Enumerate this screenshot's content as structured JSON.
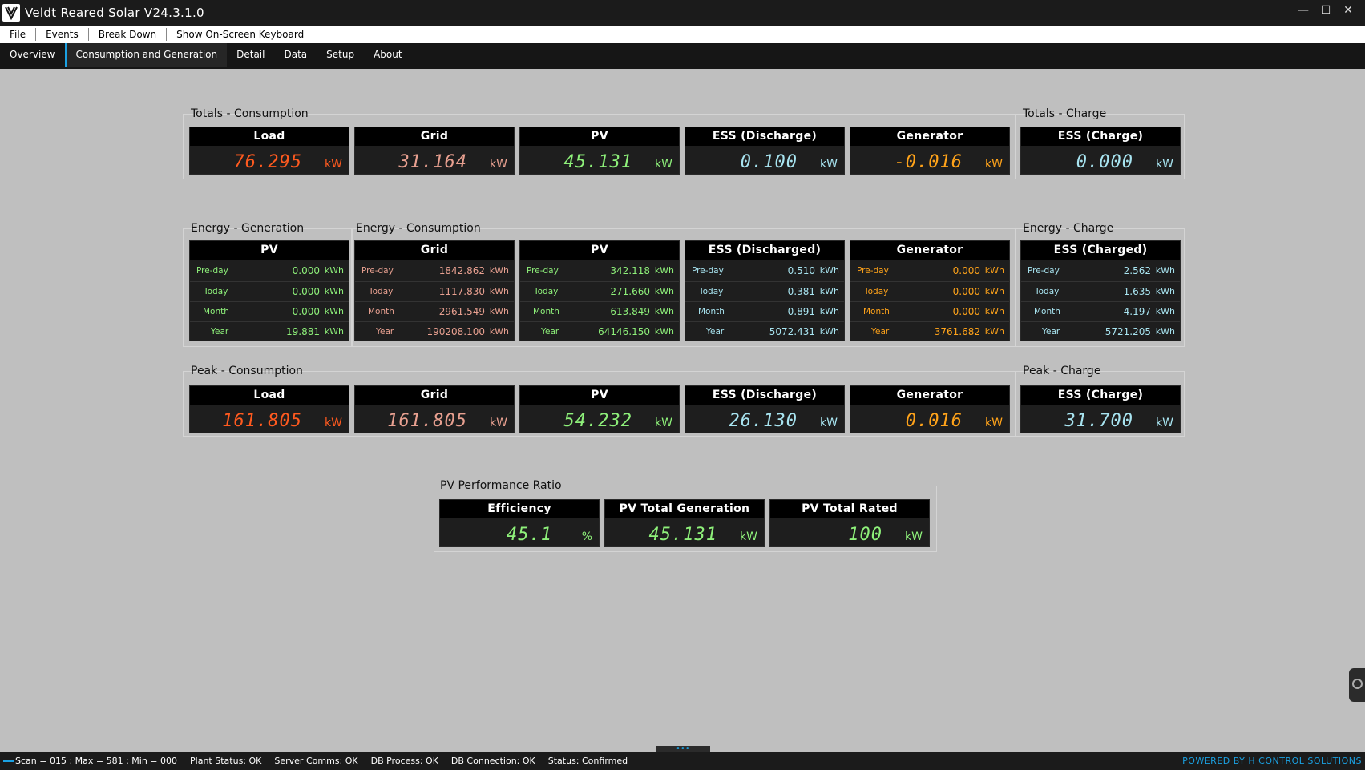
{
  "window": {
    "title": "Veldt Reared Solar V24.3.1.0",
    "controls": {
      "minimize": "—",
      "maximize": "☐",
      "close": "✕"
    }
  },
  "menu": [
    "File",
    "Events",
    "Break Down",
    "Show On-Screen Keyboard"
  ],
  "tabs": [
    "Overview",
    "Consumption and Generation",
    "Detail",
    "Data",
    "Setup",
    "About"
  ],
  "active_tab": "Consumption and Generation",
  "colors": {
    "load": "#ff5a1f",
    "grid": "#e8a090",
    "pv": "#8ef07a",
    "ess": "#a8e4f0",
    "generator": "#ffa31a",
    "accent": "#1ba1e2"
  },
  "totals_consumption": {
    "label": "Totals - Consumption",
    "cards": [
      {
        "title": "Load",
        "value": "76.295",
        "unit": "kW"
      },
      {
        "title": "Grid",
        "value": "31.164",
        "unit": "kW"
      },
      {
        "title": "PV",
        "value": "45.131",
        "unit": "kW"
      },
      {
        "title": "ESS (Discharge)",
        "value": "0.100",
        "unit": "kW"
      },
      {
        "title": "Generator",
        "value": "-0.016",
        "unit": "kW"
      }
    ]
  },
  "totals_charge": {
    "label": "Totals - Charge",
    "card": {
      "title": "ESS (Charge)",
      "value": "0.000",
      "unit": "kW"
    }
  },
  "energy_generation": {
    "label": "Energy - Generation",
    "card": {
      "title": "PV",
      "rows": [
        {
          "label": "Pre-day",
          "value": "0.000",
          "unit": "kWh"
        },
        {
          "label": "Today",
          "value": "0.000",
          "unit": "kWh"
        },
        {
          "label": "Month",
          "value": "0.000",
          "unit": "kWh"
        },
        {
          "label": "Year",
          "value": "19.881",
          "unit": "kWh"
        }
      ]
    }
  },
  "energy_consumption": {
    "label": "Energy - Consumption",
    "cards": [
      {
        "title": "Grid",
        "rows": [
          {
            "label": "Pre-day",
            "value": "1842.862",
            "unit": "kWh"
          },
          {
            "label": "Today",
            "value": "1117.830",
            "unit": "kWh"
          },
          {
            "label": "Month",
            "value": "2961.549",
            "unit": "kWh"
          },
          {
            "label": "Year",
            "value": "190208.100",
            "unit": "kWh"
          }
        ]
      },
      {
        "title": "PV",
        "rows": [
          {
            "label": "Pre-day",
            "value": "342.118",
            "unit": "kWh"
          },
          {
            "label": "Today",
            "value": "271.660",
            "unit": "kWh"
          },
          {
            "label": "Month",
            "value": "613.849",
            "unit": "kWh"
          },
          {
            "label": "Year",
            "value": "64146.150",
            "unit": "kWh"
          }
        ]
      },
      {
        "title": "ESS (Discharged)",
        "rows": [
          {
            "label": "Pre-day",
            "value": "0.510",
            "unit": "kWh"
          },
          {
            "label": "Today",
            "value": "0.381",
            "unit": "kWh"
          },
          {
            "label": "Month",
            "value": "0.891",
            "unit": "kWh"
          },
          {
            "label": "Year",
            "value": "5072.431",
            "unit": "kWh"
          }
        ]
      },
      {
        "title": "Generator",
        "rows": [
          {
            "label": "Pre-day",
            "value": "0.000",
            "unit": "kWh"
          },
          {
            "label": "Today",
            "value": "0.000",
            "unit": "kWh"
          },
          {
            "label": "Month",
            "value": "0.000",
            "unit": "kWh"
          },
          {
            "label": "Year",
            "value": "3761.682",
            "unit": "kWh"
          }
        ]
      }
    ]
  },
  "energy_charge": {
    "label": "Energy - Charge",
    "card": {
      "title": "ESS (Charged)",
      "rows": [
        {
          "label": "Pre-day",
          "value": "2.562",
          "unit": "kWh"
        },
        {
          "label": "Today",
          "value": "1.635",
          "unit": "kWh"
        },
        {
          "label": "Month",
          "value": "4.197",
          "unit": "kWh"
        },
        {
          "label": "Year",
          "value": "5721.205",
          "unit": "kWh"
        }
      ]
    }
  },
  "peak_consumption": {
    "label": "Peak - Consumption",
    "cards": [
      {
        "title": "Load",
        "value": "161.805",
        "unit": "kW"
      },
      {
        "title": "Grid",
        "value": "161.805",
        "unit": "kW"
      },
      {
        "title": "PV",
        "value": "54.232",
        "unit": "kW"
      },
      {
        "title": "ESS (Discharge)",
        "value": "26.130",
        "unit": "kW"
      },
      {
        "title": "Generator",
        "value": "0.016",
        "unit": "kW"
      }
    ]
  },
  "peak_charge": {
    "label": "Peak - Charge",
    "card": {
      "title": "ESS (Charge)",
      "value": "31.700",
      "unit": "kW"
    }
  },
  "pv_performance": {
    "label": "PV Performance Ratio",
    "cards": [
      {
        "title": "Efficiency",
        "value": "45.1",
        "unit": "%"
      },
      {
        "title": "PV Total Generation",
        "value": "45.131",
        "unit": "kW"
      },
      {
        "title": "PV Total Rated",
        "value": "100",
        "unit": "kW"
      }
    ]
  },
  "status": {
    "scan": "Scan = 015 : Max = 581 : Min = 000",
    "plant": "Plant Status: OK",
    "server": "Server Comms: OK",
    "db_process": "DB Process:  OK",
    "db_connection": "DB Connection:  OK",
    "state": "Status:  Confirmed",
    "powered_by": "POWERED BY H CONTROL SOLUTIONS"
  },
  "bottom_handle": "•••"
}
